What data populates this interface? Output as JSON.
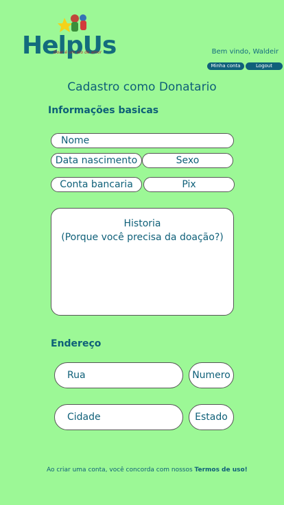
{
  "header": {
    "logo_text": "HelpUs",
    "logo_tagline": "Doar é um ato de amor",
    "welcome": "Bem vindo, Waldeir",
    "account_button": "Minha conta",
    "logout_button": "Logout"
  },
  "page_title": "Cadastro como Donatario",
  "basic_info": {
    "title": "Informações basicas",
    "name": "Nome",
    "birth_date": "Data nascimento",
    "sex": "Sexo",
    "bank_account": "Conta bancaria",
    "pix": "Pix",
    "history_line1": "Historia",
    "history_line2": "(Porque você precisa da doação?)"
  },
  "address": {
    "title": "Endereço",
    "street": "Rua",
    "number": "Numero",
    "city": "Cidade",
    "state": "Estado"
  },
  "footer": {
    "text": "Ao criar uma conta, você concorda com nossos ",
    "link": "Termos de uso!"
  }
}
